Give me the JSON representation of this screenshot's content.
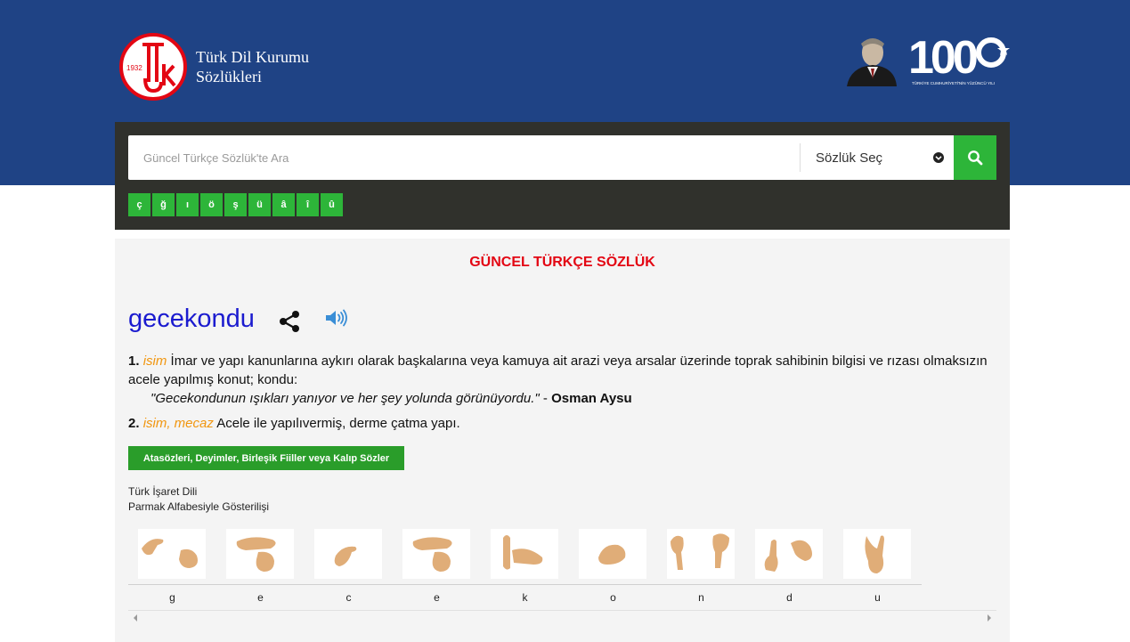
{
  "header": {
    "logo_year": "1932",
    "brand_line1": "Türk Dil Kurumu",
    "brand_line2": "Sözlükleri",
    "centennial_number": "100",
    "centennial_caption": "TÜRKİYE CUMHURİYETİ'NİN YÜZÜNCÜ YILI"
  },
  "search": {
    "placeholder": "Güncel Türkçe Sözlük'te Ara",
    "value": "",
    "dictionary_select": "Sözlük Seç",
    "special_letters": [
      "ç",
      "ğ",
      "ı",
      "ö",
      "ş",
      "ü",
      "â",
      "î",
      "û"
    ]
  },
  "result": {
    "dictionary_title": "GÜNCEL TÜRKÇE SÖZLÜK",
    "word": "gecekondu",
    "definitions": [
      {
        "num": "1.",
        "type": "isim",
        "text": "İmar ve yapı kanunlarına aykırı olarak başkalarına veya kamuya ait arazi veya arsalar üzerinde toprak sahibinin bilgisi ve rızası olmaksızın acele yapılmış konut; kondu:",
        "example": "\"Gecekondunun ışıkları yanıyor ve her şey yolunda görünüyordu.\"",
        "example_sep": " - ",
        "example_author": "Osman Aysu"
      },
      {
        "num": "2.",
        "type": "isim, mecaz",
        "text": "Acele ile yapılıvermiş, derme çatma yapı."
      }
    ],
    "phrases_button": "Atasözleri, Deyimler, Birleşik Fiiller veya Kalıp Sözler",
    "sign_title_line1": "Türk İşaret Dili",
    "sign_title_line2": "Parmak Alfabesiyle Gösterilişi",
    "sign_letters": [
      "g",
      "e",
      "c",
      "e",
      "k",
      "o",
      "n",
      "d",
      "u"
    ]
  },
  "colors": {
    "header_bg": "#1f4385",
    "search_panel_bg": "#30312c",
    "green": "#2db539",
    "title_red": "#e30613",
    "word_blue": "#1b1bcf",
    "type_orange": "#f1960f"
  }
}
